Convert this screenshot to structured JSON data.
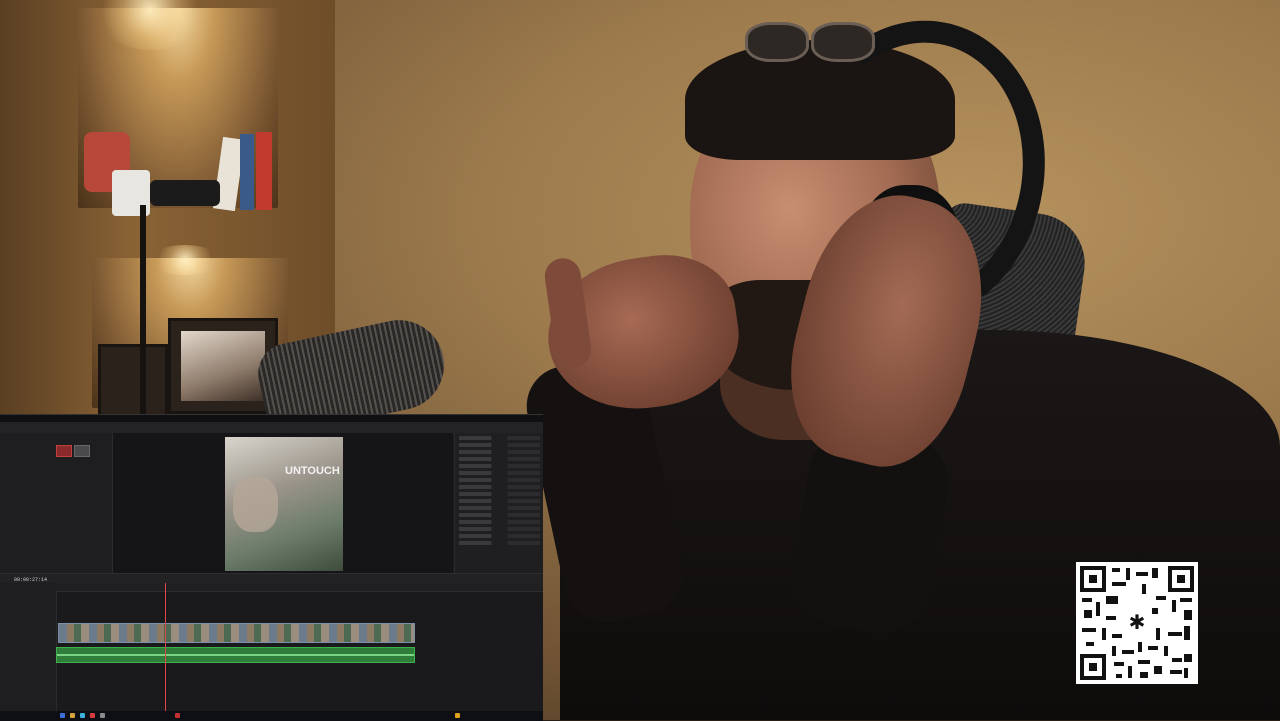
{
  "scene": {
    "description_labels": {
      "timecode": "00:00:27:14",
      "viewer_title_text": "UNTOUCH"
    }
  },
  "editor": {
    "timecode": "00:00:27:14",
    "viewer_text": "UNTOUCH"
  },
  "colors": {
    "wall": "#9c7a4c",
    "editor_bg": "#1c1c1f",
    "video_clip": "#7a8fa8",
    "audio_clip": "#2f7d3a",
    "playhead": "#e04848",
    "qr_fg": "#111111",
    "qr_bg": "#ffffff"
  },
  "icons": {
    "qr": "qr-code-icon",
    "qr_center": "asterisk-icon"
  }
}
